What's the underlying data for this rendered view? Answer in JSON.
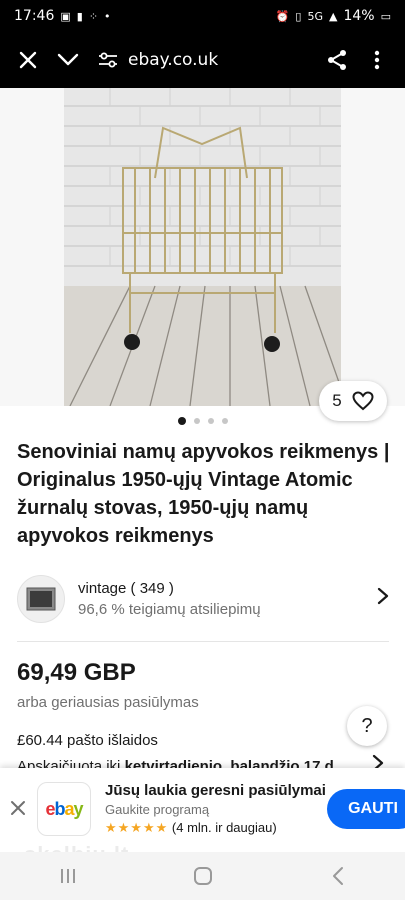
{
  "status_bar": {
    "time": "17:46",
    "battery": "14%",
    "network": "5G"
  },
  "browser": {
    "url": "ebay.co.uk"
  },
  "listing": {
    "image_count": "5",
    "title": "Senoviniai namų apyvokos reikmenys | Originalus 1950-ųjų Vintage Atomic žurnalų stovas, 1950-ųjų namų apyvokos reikmenys",
    "seller_name": "vintage ( 349 )",
    "seller_feedback": "96,6 % teigiamų atsiliepimų",
    "price": "69,49 GBP",
    "best_offer": "arba geriausias pasiūlymas",
    "shipping": "£60.44 pašto išlaidos",
    "delivery_prefix": "Apskaičiuota iki ",
    "delivery_bold": "ketvirtadienio, balandžio 17 d.",
    "help": "?"
  },
  "carousel": {
    "total": 4,
    "active": 0
  },
  "app_banner": {
    "logo_text": "ebay",
    "title": "Jūsų laukia geresni pasiūlymai",
    "subtitle": "Gaukite programą",
    "stars": "★★★★★",
    "rating_count": "(4 mln. ir daugiau)",
    "get_label": "GAUTI"
  },
  "watermark": "skelbiu.lt",
  "colors": {
    "primary_blue": "#0968f6",
    "star": "#f5a623",
    "ebay_e": "#e53238",
    "ebay_b": "#0064d2",
    "ebay_a": "#f5af02",
    "ebay_y": "#86b817"
  }
}
